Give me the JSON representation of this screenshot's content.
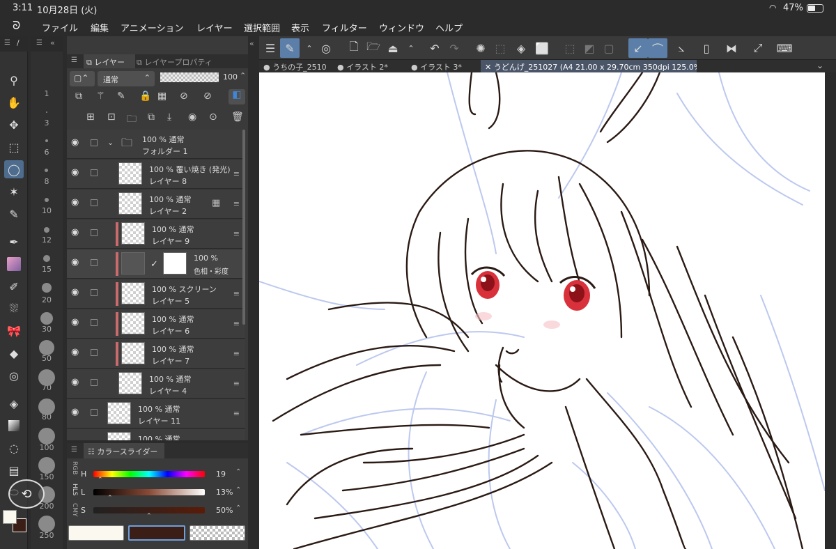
{
  "status": {
    "time": "3:11",
    "date": "10月28日 (火)",
    "battery": "47%"
  },
  "menu": [
    "ファイル",
    "編集",
    "アニメーション",
    "レイヤー",
    "選択範囲",
    "表示",
    "フィルター",
    "ウィンドウ",
    "ヘルプ"
  ],
  "tabs": [
    {
      "label": "● うちの子_2510"
    },
    {
      "label": "● イラスト 2*"
    },
    {
      "label": "● イラスト 3*"
    },
    {
      "label": "✕ うどんげ_251027 (A4 21.00 x 29.70cm 350dpi 125.0%)"
    }
  ],
  "brush_sizes": [
    "1",
    "3",
    "6",
    "8",
    "10",
    "12",
    "15",
    "20",
    "30",
    "50",
    "70",
    "80",
    "100",
    "150",
    "200",
    "250"
  ],
  "layer_panel": {
    "tab_layer": "レイヤー",
    "tab_property": "レイヤープロパティ",
    "blend_mode": "通常",
    "opacity": "100"
  },
  "layers": [
    {
      "line1": "100 % 通常",
      "line2": "フォルダー 1"
    },
    {
      "line1": "100 % 覆い焼き (発光)",
      "line2": "レイヤー 8"
    },
    {
      "line1": "100 % 通常",
      "line2": "レイヤー 2"
    },
    {
      "line1": "100 % 通常",
      "line2": "レイヤー 9"
    },
    {
      "line1": "100 % ",
      "line2": "色相・彩度"
    },
    {
      "line1": "100 % スクリーン",
      "line2": "レイヤー 5"
    },
    {
      "line1": "100 % 通常",
      "line2": "レイヤー 6"
    },
    {
      "line1": "100 % 通常",
      "line2": "レイヤー 7"
    },
    {
      "line1": "100 % 通常",
      "line2": "レイヤー 4"
    },
    {
      "line1": "100 % 通常",
      "line2": "レイヤー 11"
    },
    {
      "line1": "100 % 通常",
      "line2": ""
    }
  ],
  "color_panel": {
    "title": "カラースライダー",
    "modes": [
      "RGB",
      "HLS",
      "CMY"
    ],
    "h_label": "H",
    "h_value": "19",
    "l_label": "L",
    "l_value": "13%",
    "s_label": "S",
    "s_value": "50%"
  },
  "colors": {
    "main": "#3b1f17",
    "sub": "#fbf8f0",
    "accent": "#5b7fa8",
    "line": "#2a1a14",
    "sketch": "#bcc8ef"
  }
}
